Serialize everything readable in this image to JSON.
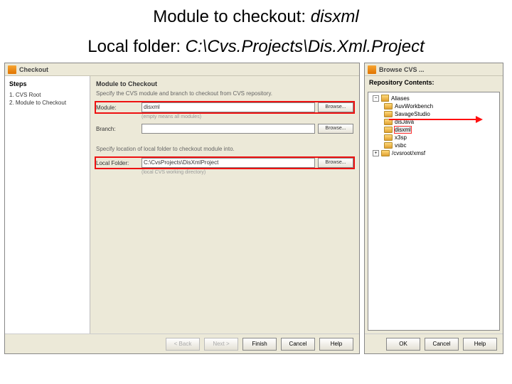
{
  "header": {
    "line1_prefix": "Module to checkout:  ",
    "line1_value": "disxml",
    "line2_prefix": "Local folder:  ",
    "line2_value": "C:\\Cvs.Projects\\Dis.Xml.Project"
  },
  "checkout": {
    "title": "Checkout",
    "steps_title": "Steps",
    "steps": {
      "s1": "1.   CVS Root",
      "s2": "2.   Module to Checkout"
    },
    "section_title": "Module to Checkout",
    "section_desc": "Specify the CVS module and branch to checkout from CVS repository.",
    "module_label": "Module:",
    "module_value": "disxml",
    "module_browse": "Browse...",
    "module_hint": "(empty means all modules)",
    "branch_label": "Branch:",
    "branch_value": "",
    "branch_browse": "Browse...",
    "folder_desc": "Specify location of local folder to checkout module into.",
    "folder_label": "Local Folder:",
    "folder_value": "C:\\CvsProjects\\DisXmlProject",
    "folder_browse": "Browse...",
    "folder_hint": "(local CVS working directory)",
    "buttons": {
      "back": "< Back",
      "next": "Next >",
      "finish": "Finish",
      "cancel": "Cancel",
      "help": "Help"
    }
  },
  "browse": {
    "title": "Browse CVS ...",
    "panel_title": "Repository Contents:",
    "root": "Aliases",
    "items": {
      "i0": "AuvWorkbench",
      "i1": "SavageStudio",
      "i2": "disJava",
      "i3": "disxml",
      "i4": "x3sp",
      "i5": "vsbc"
    },
    "bottom": "/cvsroot/xmsf",
    "toggle_minus": "−",
    "toggle_plus": "+",
    "buttons": {
      "ok": "OK",
      "cancel": "Cancel",
      "help": "Help"
    }
  }
}
